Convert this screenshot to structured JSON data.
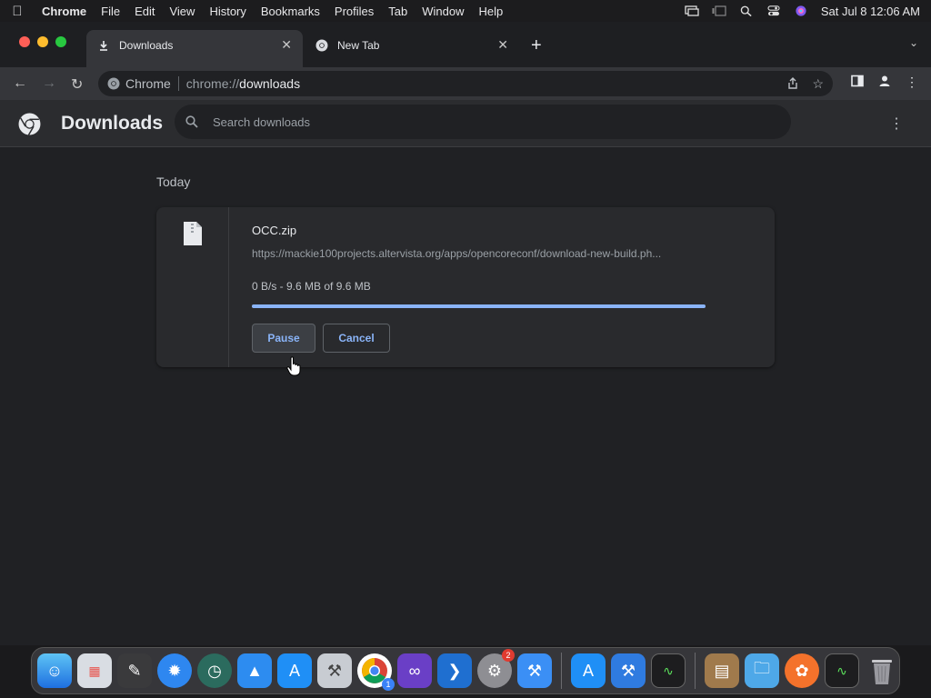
{
  "menubar": {
    "app": "Chrome",
    "items": [
      "File",
      "Edit",
      "View",
      "History",
      "Bookmarks",
      "Profiles",
      "Tab",
      "Window",
      "Help"
    ],
    "clock": "Sat Jul 8  12:06 AM"
  },
  "tabs": [
    {
      "label": "Downloads",
      "active": true
    },
    {
      "label": "New Tab",
      "active": false
    }
  ],
  "omnibox": {
    "site_label": "Chrome",
    "url_scheme": "chrome://",
    "url_host": "downloads"
  },
  "downloads": {
    "title": "Downloads",
    "search_placeholder": "Search downloads",
    "section": "Today",
    "item": {
      "name": "OCC.zip",
      "url": "https://mackie100projects.altervista.org/apps/opencoreconf/download-new-build.ph...",
      "status": "0 B/s - 9.6 MB of 9.6 MB",
      "progress_fraction": 1.0,
      "pause_label": "Pause",
      "cancel_label": "Cancel"
    }
  },
  "dock": {
    "apps": [
      {
        "icon": "finder-icon"
      },
      {
        "icon": "launchpad-icon"
      },
      {
        "icon": "notes-editor-icon"
      },
      {
        "icon": "safari-icon"
      },
      {
        "icon": "time-machine-icon"
      },
      {
        "icon": "app-store-alt-icon"
      },
      {
        "icon": "app-store-icon"
      },
      {
        "icon": "system-preferences-tool-icon"
      },
      {
        "icon": "chrome-icon",
        "badge": "1"
      },
      {
        "icon": "visual-studio-icon"
      },
      {
        "icon": "vscode-icon"
      },
      {
        "icon": "settings-icon",
        "badge": "2"
      },
      {
        "icon": "xcode-tools-icon"
      }
    ],
    "apps2": [
      {
        "icon": "app-store-icon"
      },
      {
        "icon": "xcode-icon"
      },
      {
        "icon": "activity-monitor-icon"
      }
    ],
    "apps3": [
      {
        "icon": "archive-utility-icon"
      },
      {
        "icon": "folder-icon"
      },
      {
        "icon": "firefox-icon"
      },
      {
        "icon": "activity-monitor-icon"
      },
      {
        "icon": "trash-icon"
      }
    ]
  },
  "colors": {
    "accent": "#8ab4f8",
    "background": "#202124",
    "card": "#292a2d"
  }
}
